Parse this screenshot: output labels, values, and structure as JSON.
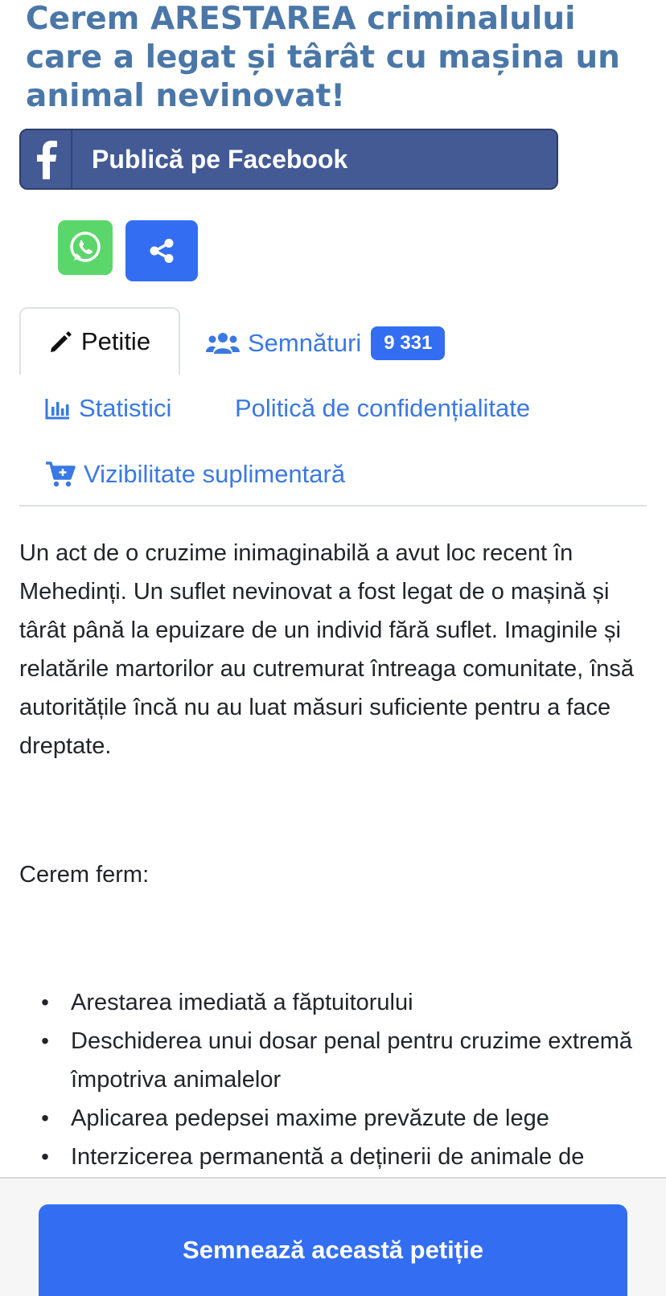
{
  "title": "Cerem ARESTAREA criminalului care a legat și târât cu mașina un animal nevinovat!",
  "share": {
    "facebook_label": "Publică pe Facebook"
  },
  "tabs": {
    "petition": "Petitie",
    "signatures": "Semnături",
    "signature_count": "9 331",
    "statistics": "Statistici",
    "privacy": "Politică de confidențialitate",
    "visibility": "Vizibilitate suplimentară"
  },
  "content": {
    "intro": "Un act de o cruzime inimaginabilă a avut loc recent în Mehedinți. Un suflet nevinovat a fost legat de o mașină și târât până la epuizare de un individ fără suflet. Imaginile și relatările martorilor au cutremurat întreaga comunitate, însă autoritățile încă nu au luat măsuri suficiente pentru a face dreptate.",
    "demand_heading": "Cerem ferm:",
    "demands": [
      "Arestarea imediată a făptuitorului",
      "Deschiderea unui dosar penal pentru cruzime extremă împotriva animalelor",
      "Aplicarea pedepsei maxime prevăzute de lege",
      "Interzicerea permanentă a deținerii de animale de"
    ]
  },
  "cta": {
    "sign_label": "Semnează această petiție"
  },
  "colors": {
    "title": "#4a77a8",
    "facebook": "#435a95",
    "whatsapp": "#5bd66b",
    "primary": "#336ef2"
  }
}
